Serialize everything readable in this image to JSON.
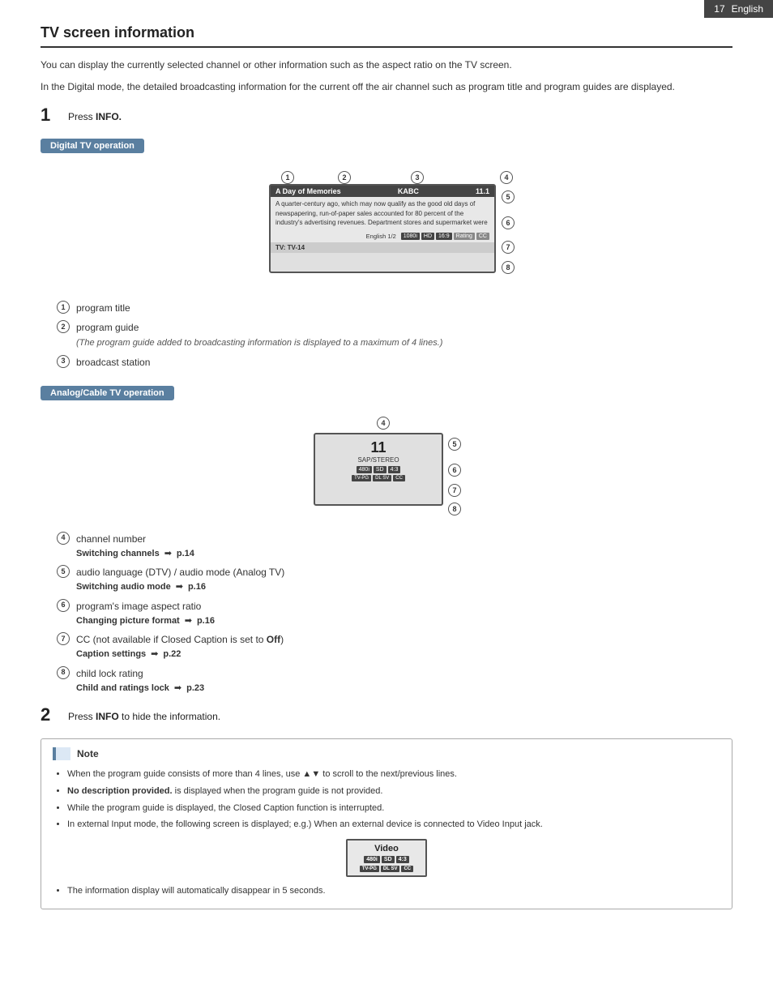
{
  "page": {
    "number": "17",
    "language": "English"
  },
  "title": "TV screen information",
  "intro": [
    "You can display the currently selected channel or other information such as the aspect ratio on the TV screen.",
    "In the Digital mode, the detailed broadcasting information for the current off the air channel such as program title and program guides are displayed."
  ],
  "step1": {
    "num": "1",
    "text": "Press ",
    "bold": "INFO."
  },
  "digital_op_label": "Digital TV operation",
  "digital_screen": {
    "program_title": "A Day of Memories",
    "station": "KABC",
    "channel": "11.1",
    "language": "English 1/2",
    "description": "A quarter-century ago, which may now qualify as the good old days of newspapering, run-of-paper sales accounted for 80 percent of the industry's advertising revenues. Department stores and supermarket were",
    "badges": [
      "1080i",
      "HD",
      "16:9"
    ],
    "rating_label": "Rating",
    "cc_label": "CC",
    "footer": "TV: TV-14"
  },
  "annotations_digital": [
    {
      "num": "1",
      "text": "program title"
    },
    {
      "num": "2",
      "text": "program guide",
      "sub": "(The program guide added to broadcasting information is displayed to a maximum of 4 lines.)"
    },
    {
      "num": "3",
      "text": "broadcast station"
    }
  ],
  "analog_op_label": "Analog/Cable TV operation",
  "analog_screen": {
    "channel": "11",
    "stereo": "SAP/STEREO",
    "badges_top": [
      "480i",
      "SD",
      "4:3"
    ],
    "badges_bottom": [
      "TV-PG",
      "DL",
      "SV",
      "CC"
    ]
  },
  "annotations_shared": [
    {
      "num": "4",
      "text": "channel number",
      "ref_label": "Switching channels",
      "ref_page": "p.14"
    },
    {
      "num": "5",
      "text": "audio language (DTV) / audio mode (Analog TV)",
      "ref_label": "Switching audio mode",
      "ref_page": "p.16"
    },
    {
      "num": "6",
      "text": "program's image aspect ratio",
      "ref_label": "Changing picture format",
      "ref_page": "p.16"
    },
    {
      "num": "7",
      "text": "CC (not available if Closed Caption is set to ",
      "bold_part": "Off",
      "text2": ")",
      "ref_label": "Caption settings",
      "ref_page": "p.22"
    },
    {
      "num": "8",
      "text": "child lock rating",
      "ref_label": "Child and ratings lock",
      "ref_page": "p.23"
    }
  ],
  "step2": {
    "num": "2",
    "text": "Press ",
    "bold": "INFO",
    "text2": " to hide the information."
  },
  "note_label": "Note",
  "note_bullets": [
    "When the program guide consists of more than 4 lines, use ▲▼ to scroll to the next/previous lines.",
    "No description provided. is displayed when the program guide is not provided.",
    "While the program guide is displayed, the Closed Caption function is interrupted.",
    "In external Input mode, the following screen is displayed; e.g.) When an external device is connected to Video Input jack."
  ],
  "note_last_bullet": "The information display will automatically disappear in 5 seconds.",
  "video_inset": {
    "label": "Video",
    "badges": [
      "480i",
      "SD",
      "4:3"
    ],
    "footer_badges": [
      "TV-PG",
      "DL",
      "SV",
      "CC"
    ]
  }
}
